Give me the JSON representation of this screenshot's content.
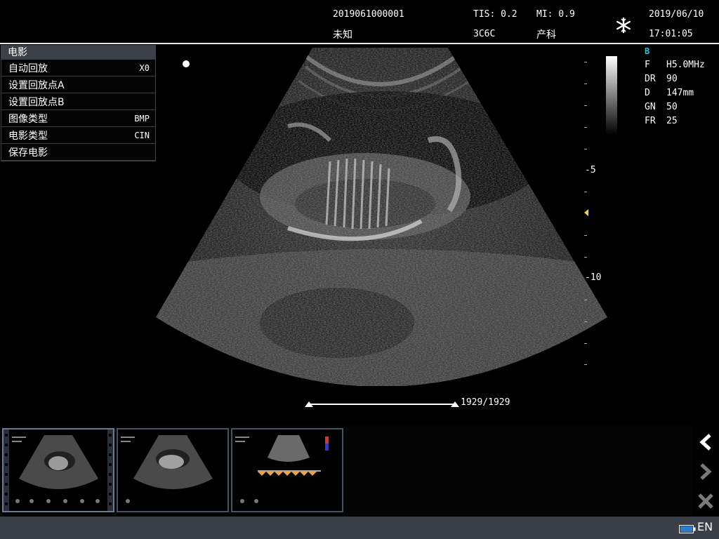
{
  "header": {
    "patient_id": "2019061000001",
    "patient_name": "未知",
    "tis": "TIS: 0.2",
    "probe": "3C6C",
    "mi": "MI: 0.9",
    "exam": "产科",
    "date": "2019/06/10",
    "time": "17:01:05",
    "freeze_icon": "snowflake-icon"
  },
  "menu": {
    "title": "电影",
    "items": [
      {
        "label": "自动回放",
        "value": "X0"
      },
      {
        "label": "设置回放点A",
        "value": ""
      },
      {
        "label": "设置回放点B",
        "value": ""
      },
      {
        "label": "图像类型",
        "value": "BMP"
      },
      {
        "label": "电影类型",
        "value": "CIN"
      },
      {
        "label": "保存电影",
        "value": ""
      }
    ]
  },
  "params": {
    "mode": "B",
    "rows": [
      {
        "key": "F",
        "value": "H5.0MHz"
      },
      {
        "key": "DR",
        "value": "90"
      },
      {
        "key": "D",
        "value": "147mm"
      },
      {
        "key": "GN",
        "value": "50"
      },
      {
        "key": "FR",
        "value": "25"
      }
    ]
  },
  "depth_labels": [
    "-5",
    "-10"
  ],
  "cine": {
    "frame_counter": "1929/1929"
  },
  "thumbnails": [
    {
      "name": "thumbnail-1"
    },
    {
      "name": "thumbnail-2"
    },
    {
      "name": "thumbnail-3"
    }
  ],
  "status": {
    "language": "EN",
    "battery_icon": "battery-icon"
  },
  "colors": {
    "menu_title_bg": "#3b4049",
    "bottom_bar": "#3a3f47",
    "mode_color": "#27c3d6",
    "focus_marker": "#f5d33a"
  }
}
